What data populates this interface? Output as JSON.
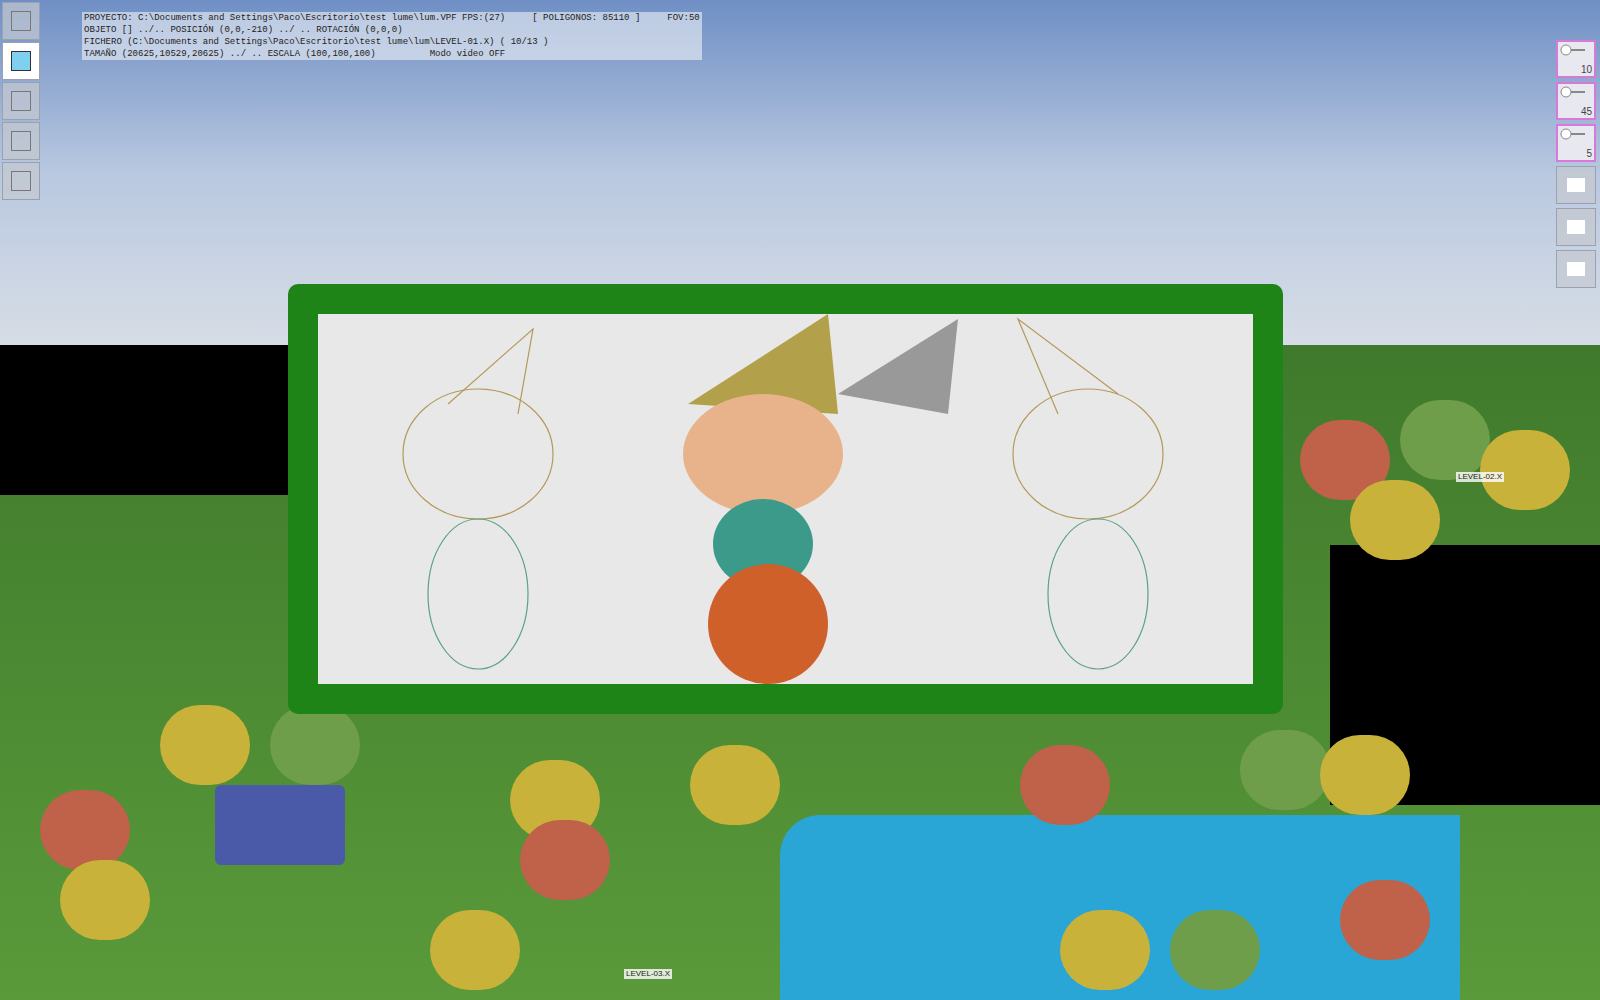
{
  "info_panel": {
    "lines": [
      "PROYECTO: C:\\Documents and Settings\\Paco\\Escritorio\\test lume\\lum.VPF FPS:(27)     [ POLIGONOS: 85110 ]     FOV:50",
      "OBJETO [] ../.. POSICIÓN (0,0,-210) ../ .. ROTACIÓN (0,0,0)",
      "FICHERO (C:\\Documents and Settings\\Paco\\Escritorio\\test lume\\lum\\LEVEL-01.X) ( 10/13 )",
      "TAMAÑO (20625,10529,20625) ../ .. ESCALA (100,100,100)          Modo video OFF"
    ]
  },
  "left_toolbar": [
    {
      "selected": false
    },
    {
      "selected": true
    },
    {
      "selected": false
    },
    {
      "selected": false
    },
    {
      "selected": false
    }
  ],
  "right_toolbar": {
    "counters": [
      {
        "value": "10"
      },
      {
        "value": "45"
      },
      {
        "value": "5"
      }
    ]
  },
  "scene_labels": [
    {
      "text": "LEVEL-02.X"
    },
    {
      "text": "LEVEL-03.X"
    }
  ]
}
